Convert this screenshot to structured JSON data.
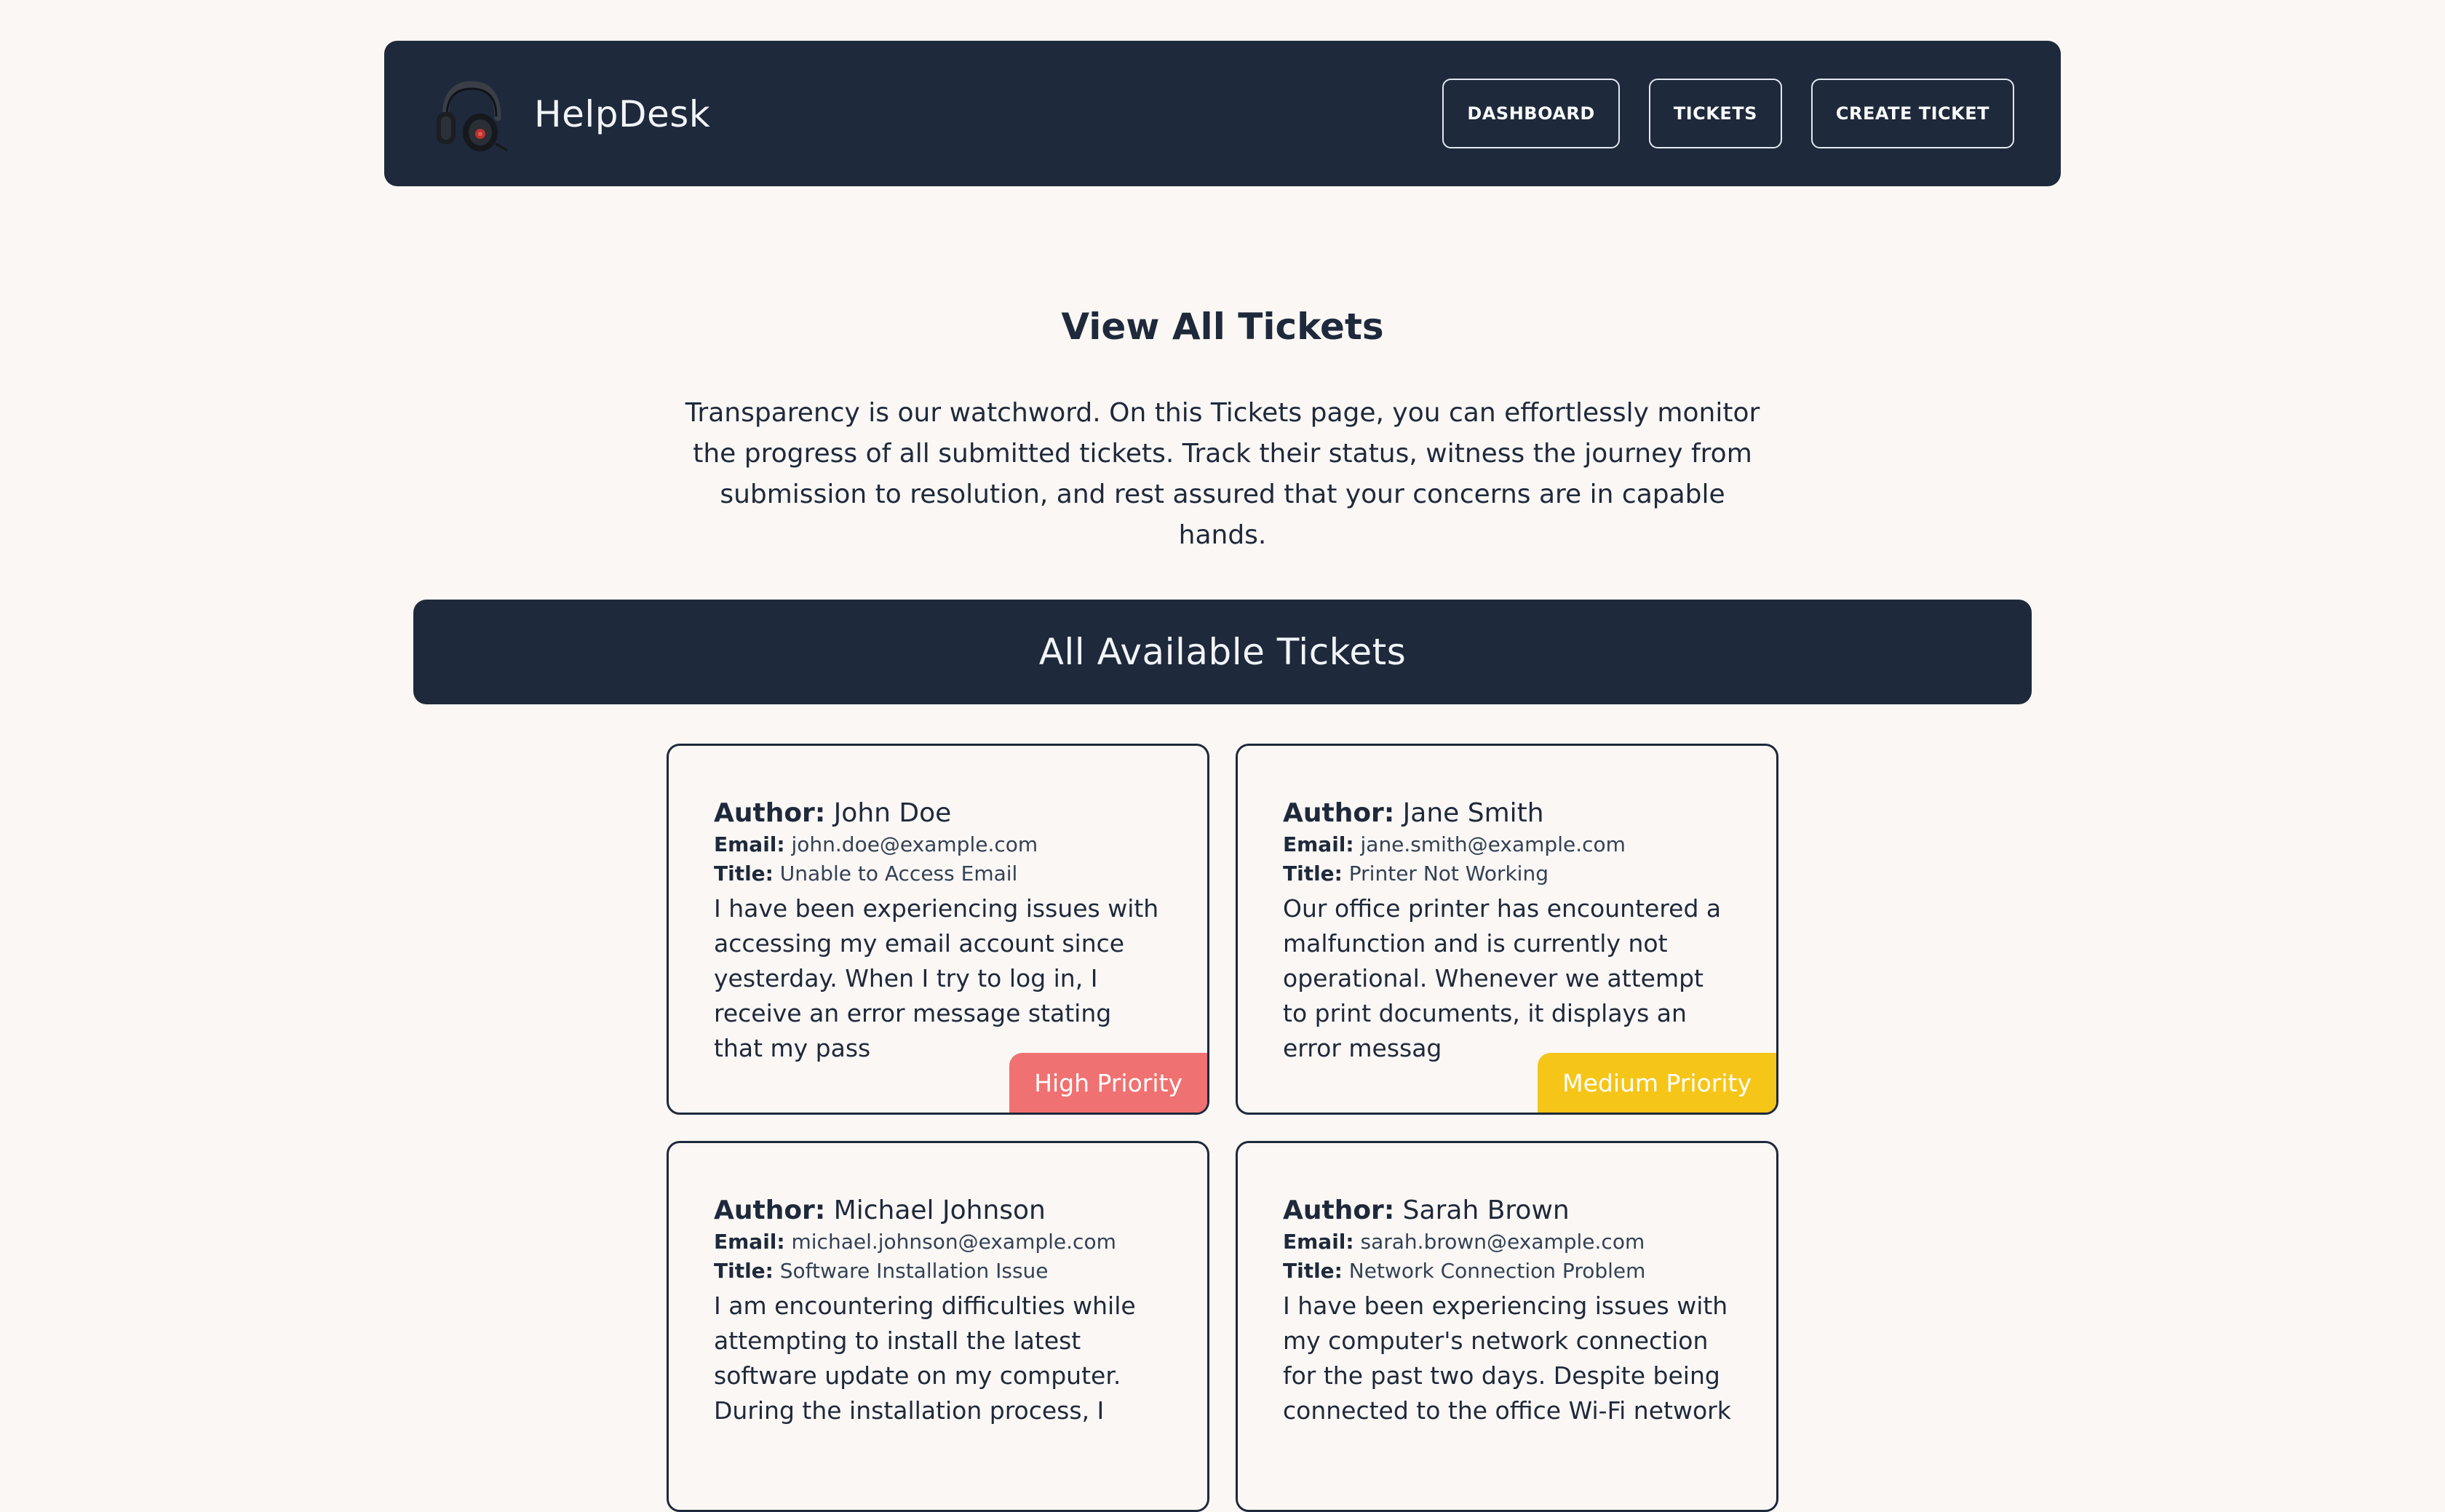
{
  "app": {
    "name": "HelpDesk",
    "logo_icon": "headphones-icon"
  },
  "nav": {
    "items": [
      {
        "label": "DASHBOARD"
      },
      {
        "label": "TICKETS"
      },
      {
        "label": "CREATE TICKET"
      }
    ]
  },
  "page": {
    "title": "View All Tickets",
    "intro": "Transparency is our watchword. On this Tickets page, you can effortlessly monitor the progress of all submitted tickets. Track their status, witness the journey from submission to resolution, and rest assured that your concerns are in capable hands.",
    "section_title": "All Available Tickets"
  },
  "labels": {
    "author": "Author:",
    "email": "Email:",
    "title": "Title:"
  },
  "colors": {
    "navy": "#1e293b",
    "background": "#faf7f4",
    "high_priority": "#f07171",
    "medium_priority": "#f5c518"
  },
  "tickets": [
    {
      "author": "John Doe",
      "email": "john.doe@example.com",
      "title": "Unable to Access Email",
      "description": "I have been experiencing issues with accessing my email account since yesterday. When I try to log in, I receive an error message stating that my pass",
      "priority": "High Priority",
      "priority_color": "#f07171"
    },
    {
      "author": "Jane Smith",
      "email": "jane.smith@example.com",
      "title": "Printer Not Working",
      "description": "Our office printer has encountered a malfunction and is currently not operational. Whenever we attempt to print documents, it displays an error messag",
      "priority": "Medium Priority",
      "priority_color": "#f5c518"
    },
    {
      "author": "Michael Johnson",
      "email": "michael.johnson@example.com",
      "title": "Software Installation Issue",
      "description": "I am encountering difficulties while attempting to install the latest software update on my computer. During the installation process, I",
      "priority": "",
      "priority_color": ""
    },
    {
      "author": "Sarah Brown",
      "email": "sarah.brown@example.com",
      "title": "Network Connection Problem",
      "description": "I have been experiencing issues with my computer's network connection for the past two days. Despite being connected to the office Wi-Fi network",
      "priority": "",
      "priority_color": ""
    }
  ]
}
